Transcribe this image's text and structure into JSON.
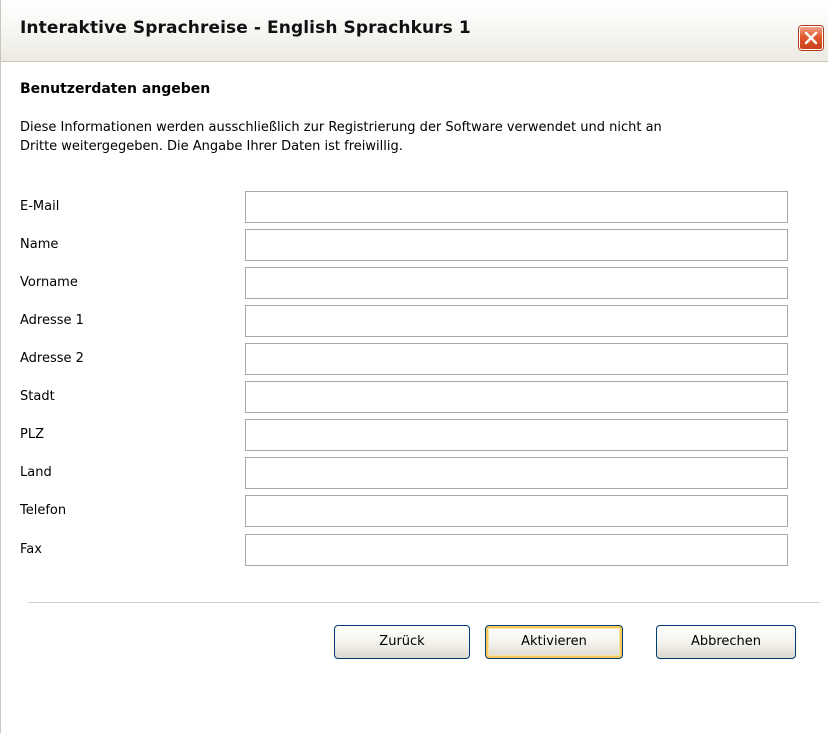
{
  "window": {
    "title": "Interaktive Sprachreise - English Sprachkurs 1",
    "close_icon": "close-icon"
  },
  "form": {
    "heading": "Benutzerdaten angeben",
    "info_line_1": "Diese Informationen werden ausschließlich zur Registrierung der Software verwendet und nicht an",
    "info_line_2": "Dritte weitergegeben. Die Angabe Ihrer Daten ist freiwillig.",
    "fields": [
      {
        "label": "E-Mail",
        "value": ""
      },
      {
        "label": "Name",
        "value": ""
      },
      {
        "label": "Vorname",
        "value": ""
      },
      {
        "label": "Adresse 1",
        "value": ""
      },
      {
        "label": "Adresse 2",
        "value": ""
      },
      {
        "label": "Stadt",
        "value": ""
      },
      {
        "label": "PLZ",
        "value": ""
      },
      {
        "label": "Land",
        "value": ""
      },
      {
        "label": "Telefon",
        "value": ""
      },
      {
        "label": "Fax",
        "value": ""
      }
    ]
  },
  "buttons": {
    "back": "Zurück",
    "activate": "Aktivieren",
    "cancel": "Abbrechen"
  },
  "colors": {
    "dialog_background": "#ffffff",
    "close_button": "#e2582e",
    "default_button_highlight": "#f7c85a"
  }
}
